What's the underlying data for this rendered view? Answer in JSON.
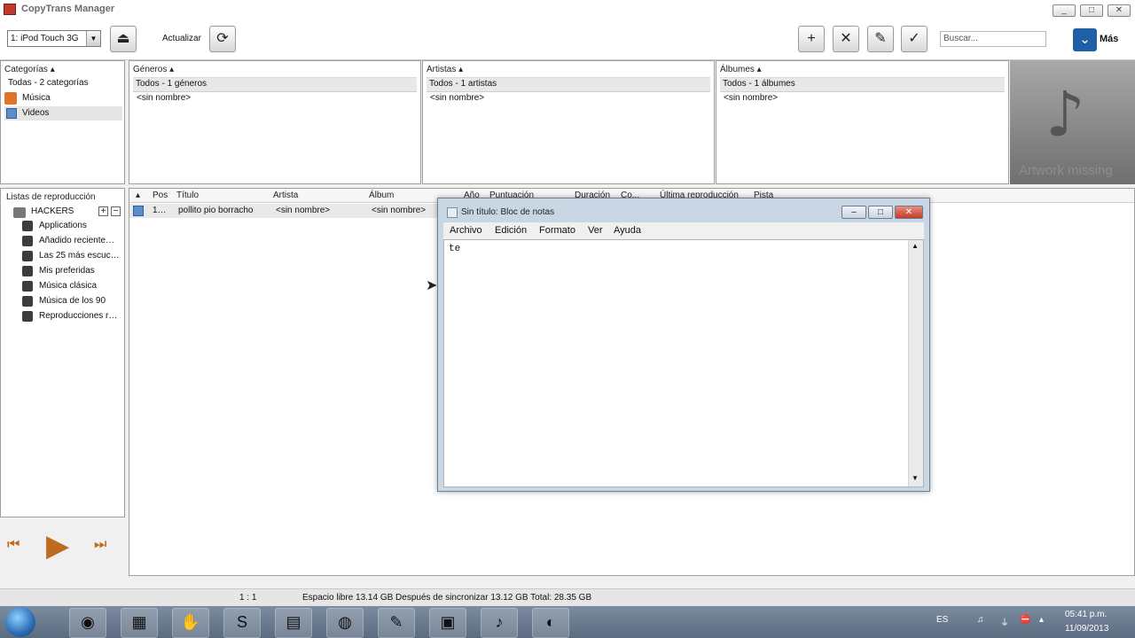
{
  "window": {
    "title": "CopyTrans Manager",
    "controls": [
      "_",
      "□",
      "✕"
    ]
  },
  "toolbar": {
    "device": "1: iPod Touch 3G",
    "refresh_label": "Actualizar",
    "search_placeholder": "Buscar...",
    "more_label": "Más"
  },
  "categories": {
    "header": "Categorías",
    "all": "Todas - 2 categorías",
    "items": [
      "Música",
      "Videos"
    ]
  },
  "genres": {
    "header": "Géneros",
    "all": "Todos - 1 géneros",
    "item": "<sin nombre>"
  },
  "artists": {
    "header": "Artistas",
    "all": "Todos - 1 artistas",
    "item": "<sin nombre>"
  },
  "albums": {
    "header": "Álbumes",
    "all": "Todos - 1 álbumes",
    "item": "<sin nombre>"
  },
  "artwork": {
    "text": "Artwork missing"
  },
  "playlists": {
    "header": "Listas de reproducción",
    "device_name": "HACKERS",
    "items": [
      "Applications",
      "Añadido reciente…",
      "Las 25 más escuc…",
      "Mis preferidas",
      "Música clásica",
      "Música de los 90",
      "Reproducciones r…"
    ]
  },
  "tracks": {
    "columns": [
      "Pos",
      "Título",
      "Artista",
      "Álbum",
      "Año",
      "Puntuación",
      "Duración",
      "Co...",
      "Última reproducción",
      "Pista"
    ],
    "rows": [
      {
        "pos": "1…",
        "title": "pollito pio borracho",
        "artist": "<sin nombre>",
        "album": "<sin nombre>"
      }
    ]
  },
  "notepad": {
    "title": "Sin título: Bloc de notas",
    "menu": [
      "Archivo",
      "Edición",
      "Formato",
      "Ver",
      "Ayuda"
    ],
    "content": "te"
  },
  "status": {
    "position": "1 : 1",
    "space": "Espacio libre 13.14 GB Después de sincronizar 13.12 GB Total: 28.35 GB"
  },
  "taskbar": {
    "lang": "ES",
    "time": "05:41 p.m.",
    "date": "11/09/2013"
  }
}
